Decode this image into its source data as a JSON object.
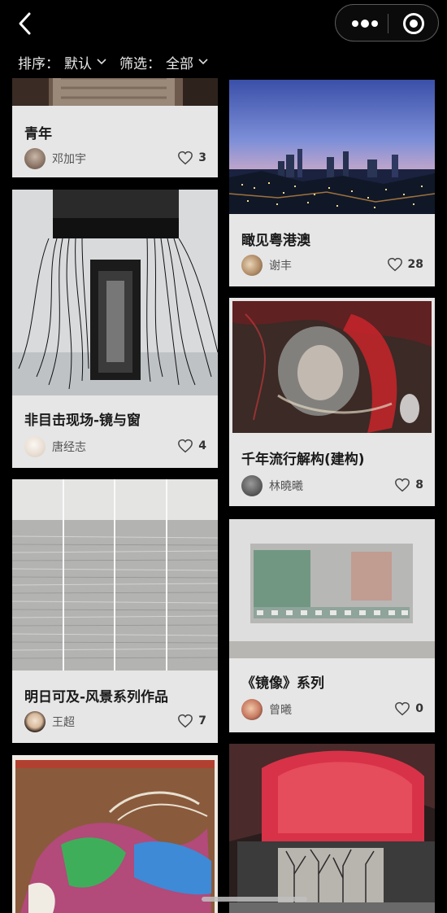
{
  "filters": {
    "sort_label": "排序：",
    "sort_value": "默认",
    "filter_label": "筛选：",
    "filter_value": "全部"
  },
  "cards": [
    {
      "title": "青年",
      "author": "邓加宇",
      "likes": "3"
    },
    {
      "title": "瞰见粤港澳",
      "author": "谢丰",
      "likes": "28"
    },
    {
      "title": "非目击现场-镜与窗",
      "author": "唐经志",
      "likes": "4"
    },
    {
      "title": "千年流行解构(建构)",
      "author": "林曉曦",
      "likes": "8"
    },
    {
      "title": "明日可及-风景系列作品",
      "author": "王超",
      "likes": "7"
    },
    {
      "title": "《镜像》系列",
      "author": "曾曦",
      "likes": "0"
    }
  ],
  "colors": {
    "background": "#000000",
    "card_info": "#e6e6e6"
  }
}
